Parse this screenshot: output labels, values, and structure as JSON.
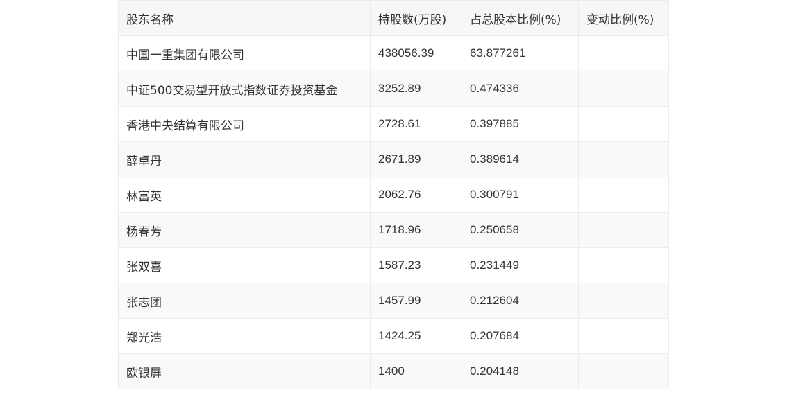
{
  "table": {
    "headers": [
      "股东名称",
      "持股数(万股)",
      "占总股本比例(%)",
      "变动比例(%)"
    ],
    "rows": [
      [
        "中国一重集团有限公司",
        "438056.39",
        "63.877261",
        ""
      ],
      [
        "中证500交易型开放式指数证券投资基金",
        "3252.89",
        "0.474336",
        ""
      ],
      [
        "香港中央结算有限公司",
        "2728.61",
        "0.397885",
        ""
      ],
      [
        "薛卓丹",
        "2671.89",
        "0.389614",
        ""
      ],
      [
        "林富英",
        "2062.76",
        "0.300791",
        ""
      ],
      [
        "杨春芳",
        "1718.96",
        "0.250658",
        ""
      ],
      [
        "张双喜",
        "1587.23",
        "0.231449",
        ""
      ],
      [
        "张志团",
        "1457.99",
        "0.212604",
        ""
      ],
      [
        "郑光浩",
        "1424.25",
        "0.207684",
        ""
      ],
      [
        "欧银屏",
        "1400",
        "0.204148",
        ""
      ]
    ]
  }
}
